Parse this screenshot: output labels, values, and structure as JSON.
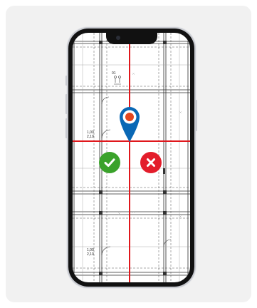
{
  "plan_labels": {
    "room_number": "01",
    "door_a_top": "1,00",
    "door_a_bottom": "2,10",
    "door_b_top": "1,00",
    "door_b_bottom": "2,10"
  },
  "icons": {
    "location_pin": "map-pin-icon",
    "accept": "check-icon",
    "reject": "close-icon"
  },
  "colors": {
    "pin": "#0a68b5",
    "pin_dot": "#e4461d",
    "crosshair": "#e0171c",
    "accept": "#3aa22b",
    "reject": "#e31d2b"
  }
}
